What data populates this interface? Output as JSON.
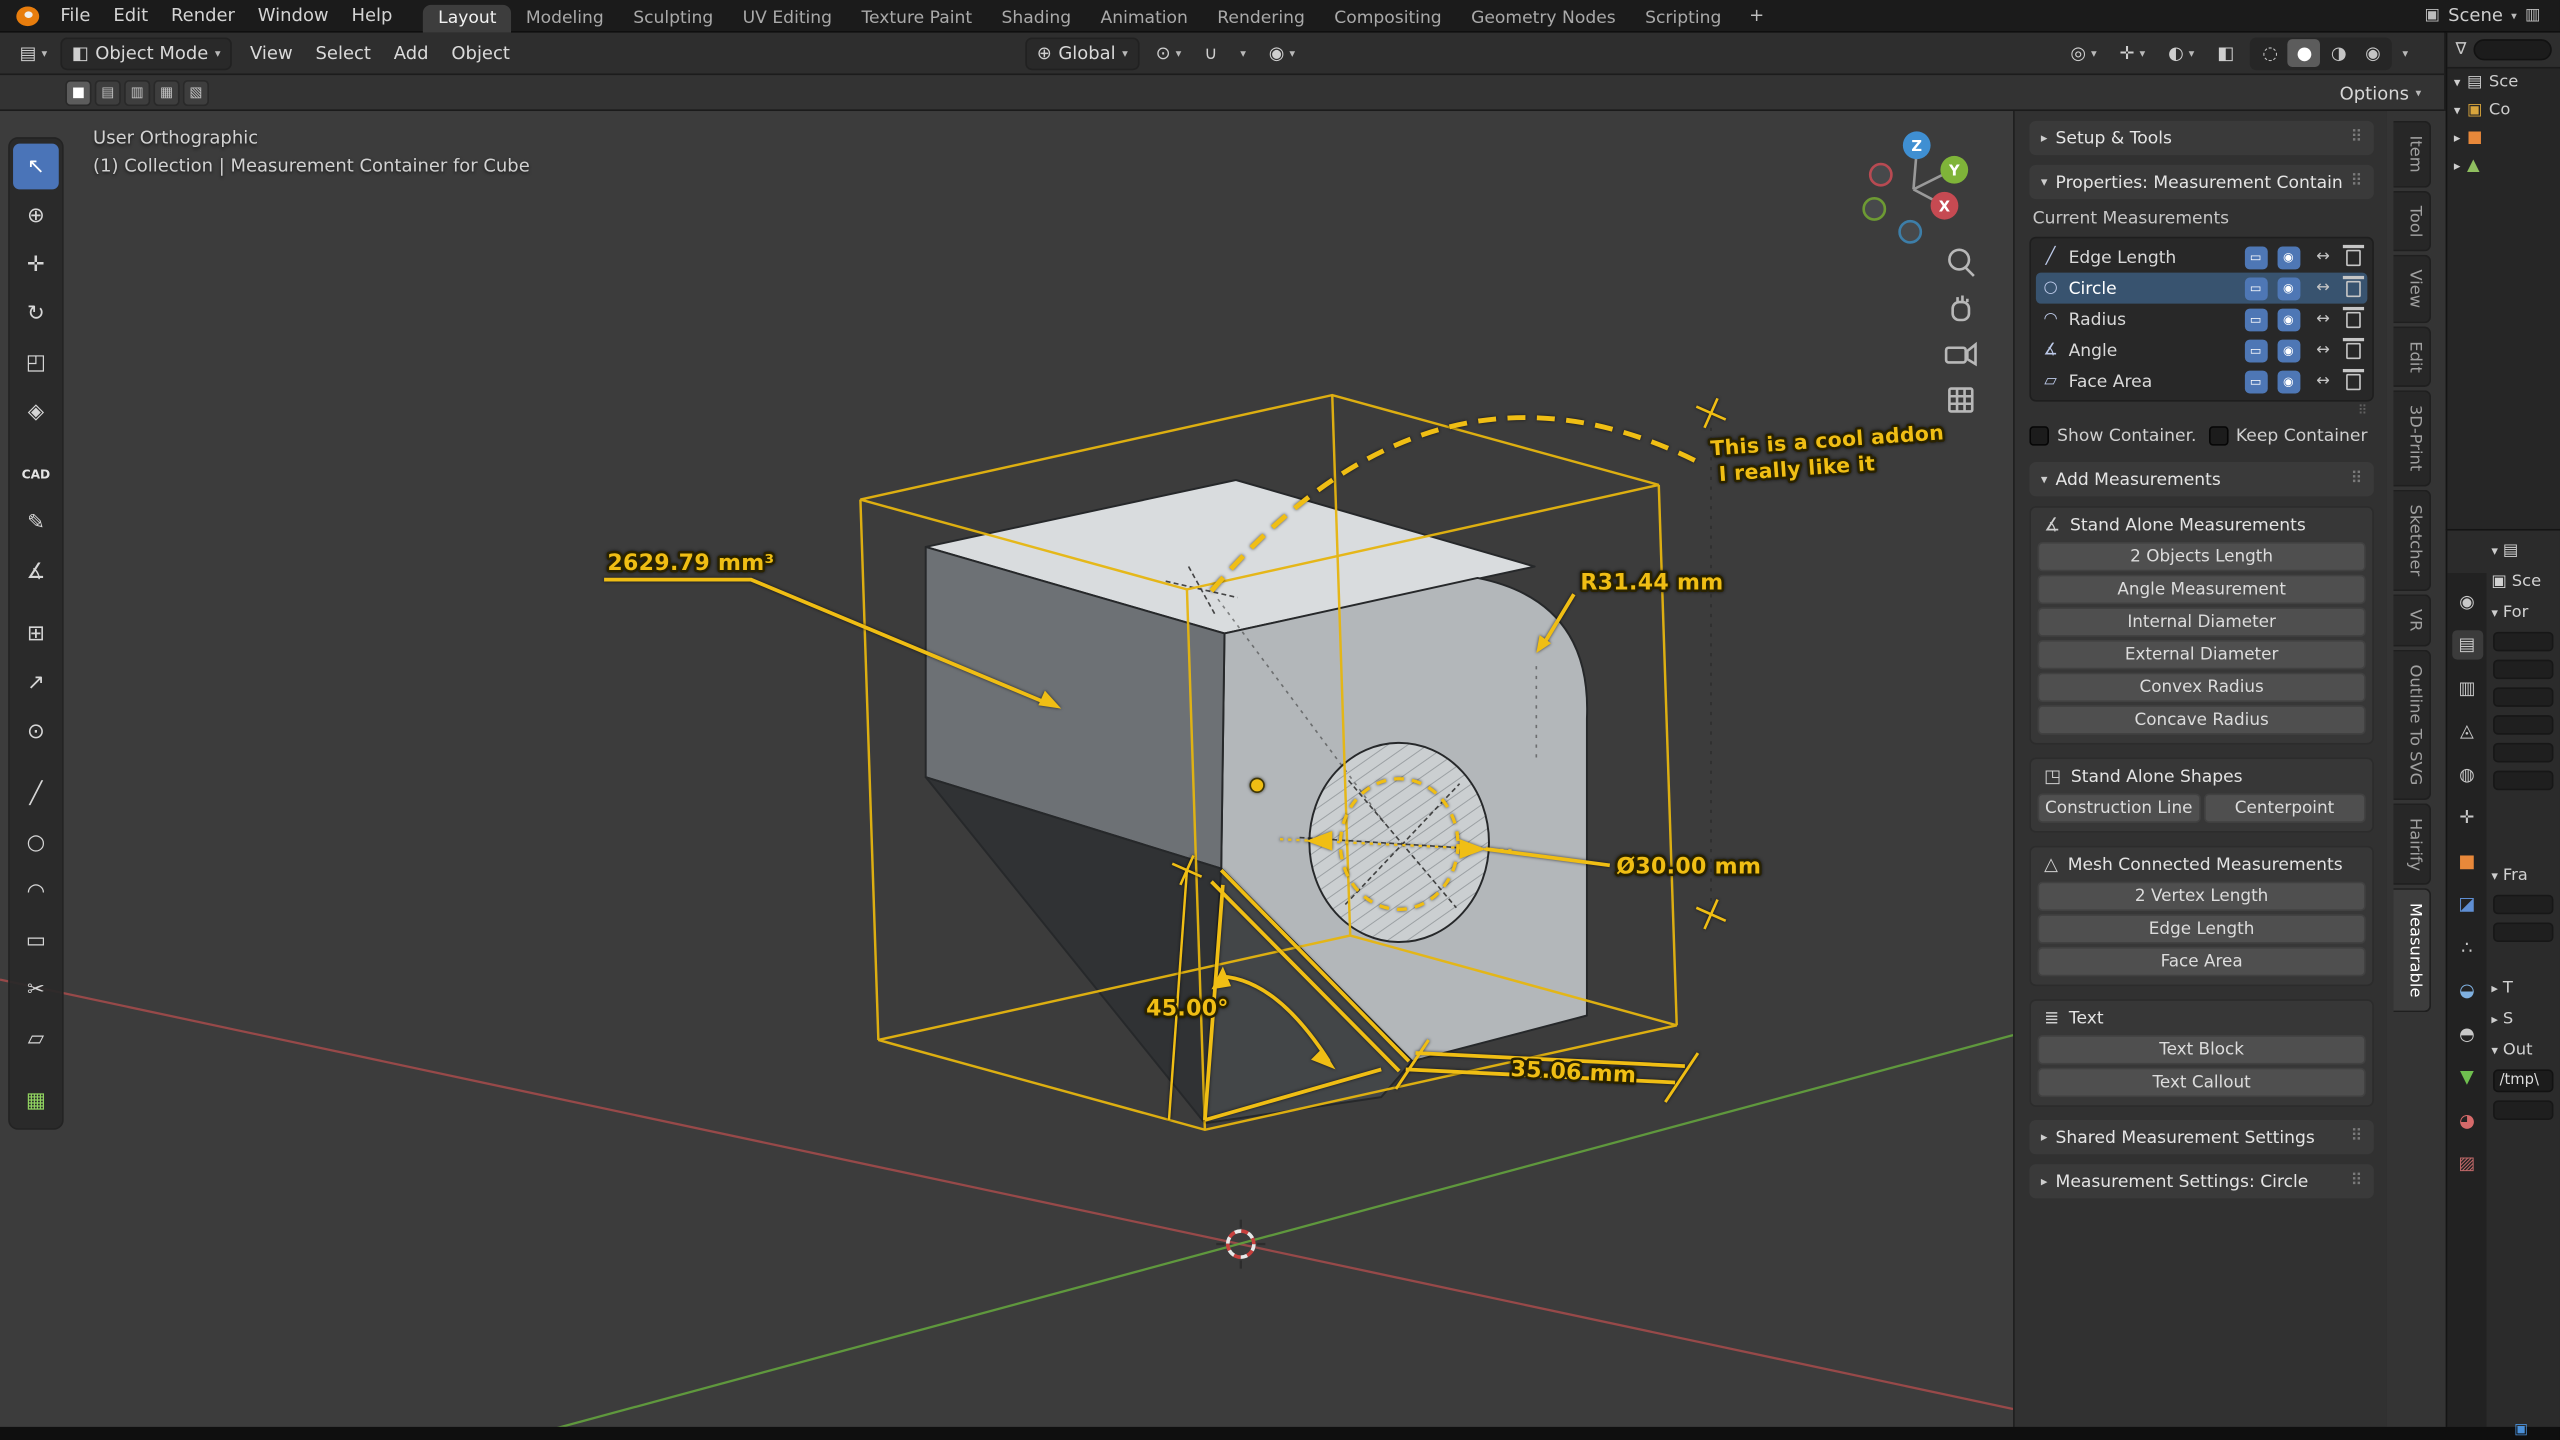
{
  "topbar": {
    "menus": [
      "File",
      "Edit",
      "Render",
      "Window",
      "Help"
    ],
    "workspaces": [
      {
        "label": "Layout",
        "active": true
      },
      {
        "label": "Modeling"
      },
      {
        "label": "Sculpting"
      },
      {
        "label": "UV Editing"
      },
      {
        "label": "Texture Paint"
      },
      {
        "label": "Shading"
      },
      {
        "label": "Animation"
      },
      {
        "label": "Rendering"
      },
      {
        "label": "Compositing"
      },
      {
        "label": "Geometry Nodes"
      },
      {
        "label": "Scripting"
      }
    ],
    "add_tab": "+",
    "scene_label": "Scene"
  },
  "header": {
    "mode": "Object Mode",
    "menus": [
      "View",
      "Select",
      "Add",
      "Object"
    ],
    "orientation": "Global",
    "options": "Options"
  },
  "select_modes": [
    {
      "name": "new",
      "glyph": "■",
      "active": true
    },
    {
      "name": "extend",
      "glyph": "▤"
    },
    {
      "name": "subtract",
      "glyph": "▥"
    },
    {
      "name": "invert",
      "glyph": "▦"
    },
    {
      "name": "intersect",
      "glyph": "▧"
    }
  ],
  "toolbar": {
    "tools": [
      {
        "name": "select-box",
        "glyph": "↖",
        "active": true
      },
      {
        "name": "cursor",
        "glyph": "⊕"
      },
      {
        "name": "move",
        "glyph": "✛"
      },
      {
        "name": "rotate",
        "glyph": "↻"
      },
      {
        "name": "scale",
        "glyph": "◰"
      },
      {
        "name": "transform",
        "glyph": "◈"
      },
      {
        "name": "cad-sketcher",
        "glyph": "CAD",
        "cls": "txt gap"
      },
      {
        "name": "annotate",
        "glyph": "✎"
      },
      {
        "name": "measure",
        "glyph": "∡"
      },
      {
        "name": "add-cube",
        "glyph": "⊞",
        "cls": "gap"
      },
      {
        "name": "extrude",
        "glyph": "↗"
      },
      {
        "name": "point",
        "glyph": "⊙"
      },
      {
        "name": "line",
        "glyph": "╱",
        "cls": "gap"
      },
      {
        "name": "circle",
        "glyph": "○"
      },
      {
        "name": "arc",
        "glyph": "◠"
      },
      {
        "name": "rectangle",
        "glyph": "▭"
      },
      {
        "name": "trim",
        "glyph": "✂"
      },
      {
        "name": "polygon",
        "glyph": "▱"
      },
      {
        "name": "workplane",
        "glyph": "▦",
        "cls": "green gap"
      }
    ]
  },
  "viewport": {
    "label_line1": "User Orthographic",
    "label_line2": "(1) Collection | Measurement Container for Cube",
    "gizmo": {
      "x": "X",
      "y": "Y",
      "z": "Z"
    },
    "annotations": {
      "volume": "2629.79 mm³",
      "radius": "R31.44 mm",
      "diameter": "Ø30.00 mm",
      "angle": "45.00°",
      "length": "35.06 mm",
      "note1": "This is a cool addon",
      "note2": "I really like it"
    }
  },
  "sidebar": {
    "tabs": [
      {
        "label": "Item"
      },
      {
        "label": "Tool"
      },
      {
        "label": "View"
      },
      {
        "label": "Edit"
      },
      {
        "label": "3D-Print"
      },
      {
        "label": "Sketcher"
      },
      {
        "label": "VR"
      },
      {
        "label": "Outline To SVG"
      },
      {
        "label": "Hairify"
      },
      {
        "label": "Measurable",
        "active": true
      }
    ],
    "setup_tools": "Setup & Tools",
    "properties_header": "Properties: Measurement Container for Cube",
    "current_measurements": "Current Measurements",
    "measurements": [
      {
        "name": "Edge Length",
        "glyph": "╱"
      },
      {
        "name": "Circle",
        "glyph": "○",
        "selected": true
      },
      {
        "name": "Radius",
        "glyph": "◠"
      },
      {
        "name": "Angle",
        "glyph": "∡"
      },
      {
        "name": "Face Area",
        "glyph": "▱"
      }
    ],
    "show_container": "Show Container...",
    "keep_container": "Keep Container i...",
    "add_measurements": "Add Measurements",
    "standalone": {
      "title": "Stand Alone Measurements",
      "buttons": [
        "2 Objects Length",
        "Angle Measurement",
        "Internal Diameter",
        "External Diameter",
        "Convex Radius",
        "Concave Radius"
      ]
    },
    "shapes": {
      "title": "Stand Alone Shapes",
      "buttons": [
        "Construction Line",
        "Centerpoint"
      ]
    },
    "mesh": {
      "title": "Mesh Connected Measurements",
      "buttons": [
        "2 Vertex Length",
        "Edge Length",
        "Face Area"
      ]
    },
    "text": {
      "title": "Text",
      "buttons": [
        "Text Block",
        "Text Callout"
      ]
    },
    "shared_settings": "Shared Measurement Settings",
    "measurement_settings": "Measurement Settings: Circle"
  },
  "outliner": {
    "rows": [
      {
        "arrow": "▾",
        "glyph": "▤",
        "color": "#cccccc",
        "label": "Sce"
      },
      {
        "arrow": "▾",
        "glyph": "▣",
        "color": "#d8a43c",
        "label": "Co"
      },
      {
        "arrow": "▸",
        "glyph": "■",
        "color": "#e8883a",
        "label": ""
      },
      {
        "arrow": "▸",
        "glyph": "▲",
        "color": "#8fbf5f",
        "label": ""
      }
    ]
  },
  "properties": {
    "breadcrumb": "Sce",
    "sections": [
      {
        "arrow": "▾",
        "label": "For"
      },
      {
        "arrow": "▾",
        "label": "Fra"
      },
      {
        "arrow": "▸",
        "label": "T"
      },
      {
        "arrow": "▸",
        "label": "S"
      },
      {
        "arrow": "▾",
        "label": "Out"
      }
    ],
    "path_value": "/tmp\\",
    "tabs": [
      {
        "name": "render",
        "glyph": "◉",
        "color": "#c8c8c8"
      },
      {
        "name": "output",
        "glyph": "▤",
        "color": "#c8c8c8",
        "active": true
      },
      {
        "name": "view-layer",
        "glyph": "▥",
        "color": "#c8c8c8"
      },
      {
        "name": "scene",
        "glyph": "◬",
        "color": "#c8c8c8"
      },
      {
        "name": "world",
        "glyph": "◍",
        "color": "#c8c8c8"
      },
      {
        "name": "tool",
        "glyph": "✛",
        "color": "#c8c8c8"
      },
      {
        "name": "object",
        "glyph": "■",
        "color": "#e8883a"
      },
      {
        "name": "modifiers",
        "glyph": "◪",
        "color": "#5f8fd4"
      },
      {
        "name": "particles",
        "glyph": "∴",
        "color": "#c8c8c8"
      },
      {
        "name": "physics",
        "glyph": "◒",
        "color": "#7fb0e0"
      },
      {
        "name": "constraints",
        "glyph": "◓",
        "color": "#c8c8c8"
      },
      {
        "name": "data",
        "glyph": "▼",
        "color": "#6fbf4f"
      },
      {
        "name": "material",
        "glyph": "◕",
        "color": "#d66a6a"
      },
      {
        "name": "texture",
        "glyph": "▨",
        "color": "#c06868"
      }
    ]
  },
  "icons": {
    "editor_type": "▤",
    "mode": "◧",
    "chev_down": "▾",
    "chev_right": "▸",
    "globe": "⊕",
    "pivot": "⊙",
    "magnet": "∪",
    "proportional": "◉",
    "visibility": "◎",
    "gizmo": "✛",
    "overlays": "◐",
    "xray": "◧",
    "shade_wire": "◌",
    "shade_solid": "●",
    "shade_material": "◑",
    "shade_render": "◉",
    "scene_icon": "▣",
    "viewlayer_icon": "▥",
    "grip": "⠿",
    "funnel": "∇",
    "standalone_icon": "∡",
    "shapes_icon": "◳",
    "mesh_icon": "△",
    "text_icon": "≣",
    "toggle_display": "▭",
    "toggle_render": "◉",
    "style": "↔",
    "status": "▣"
  },
  "colors": {
    "accent_blue": "#4a74b8",
    "measure_yellow": "#f0be14",
    "axis_x": "#a84c4c",
    "axis_y": "#63a23e",
    "object_orange": "#e8883a"
  }
}
